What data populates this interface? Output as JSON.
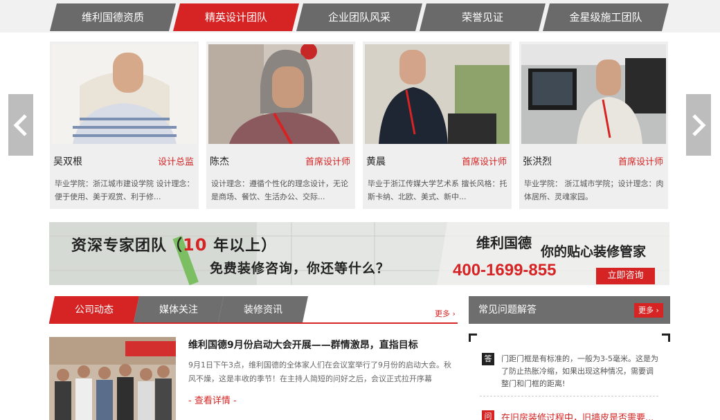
{
  "top_tabs": [
    {
      "label": "维利国德资质",
      "active": false
    },
    {
      "label": "精英设计团队",
      "active": true
    },
    {
      "label": "企业团队风采",
      "active": false
    },
    {
      "label": "荣誉见证",
      "active": false
    },
    {
      "label": "金星级施工团队",
      "active": false
    }
  ],
  "carousel": {
    "prev_icon": "chevron-left-icon",
    "next_icon": "chevron-right-icon",
    "designers": [
      {
        "name": "吴双根",
        "role": "设计总监",
        "desc": "毕业学院：浙江城市建设学院 设计理念：便于使用、美于观赏、利于修..."
      },
      {
        "name": "陈杰",
        "role": "首席设计师",
        "desc": "设计理念：遵循个性化的理念设计，无论是商场、餐饮、生活办公、交际..."
      },
      {
        "name": "黄晨",
        "role": "首席设计师",
        "desc": "毕业于浙江传媒大学艺术系 擅长风格：托斯卡纳、北欧、美式、新中..."
      },
      {
        "name": "张洪烈",
        "role": "首席设计师",
        "desc": "毕业学院： 浙江城市学院；设计理念：肉体居所、灵魂家园。"
      }
    ]
  },
  "banner": {
    "headline_prefix": "资深专家团队（",
    "headline_number": "10",
    "headline_suffix": " 年以上）",
    "subline": "免费装修咨询，你还等什么？",
    "brand": "维利国德",
    "slogan": "你的贴心装修管家",
    "phone": "400-1699-855",
    "cta": "立即咨询"
  },
  "news": {
    "tabs": [
      {
        "label": "公司动态",
        "active": true
      },
      {
        "label": "媒体关注",
        "active": false
      },
      {
        "label": "装修资讯",
        "active": false
      }
    ],
    "more": "更多",
    "article": {
      "title": "维利国德9月份启动大会开展——群情激昂，直指目标",
      "summary": "9月1日下午3点，维利国德的全体家人们在会议室举行了9月份的启动大会。秋风不燥，这是丰收的季节！在主持人简短的问好之后，会议正式拉开序幕",
      "detail_link": "- 查看详情 -"
    }
  },
  "faq": {
    "title": "常见问题解答",
    "more": "更多",
    "answer_mark": "答",
    "answer": "门距门框是有标准的，一般为3-5毫米。这是为了防止热胀冷缩，如果出现这种情况，需要调整门和门框的距离!",
    "question_mark": "问",
    "question": "在旧房装修过程中，旧墙皮是否需要..."
  },
  "colors": {
    "accent": "#d62323",
    "tab_gray": "#6a6a6a",
    "card_bg": "#efefef"
  }
}
